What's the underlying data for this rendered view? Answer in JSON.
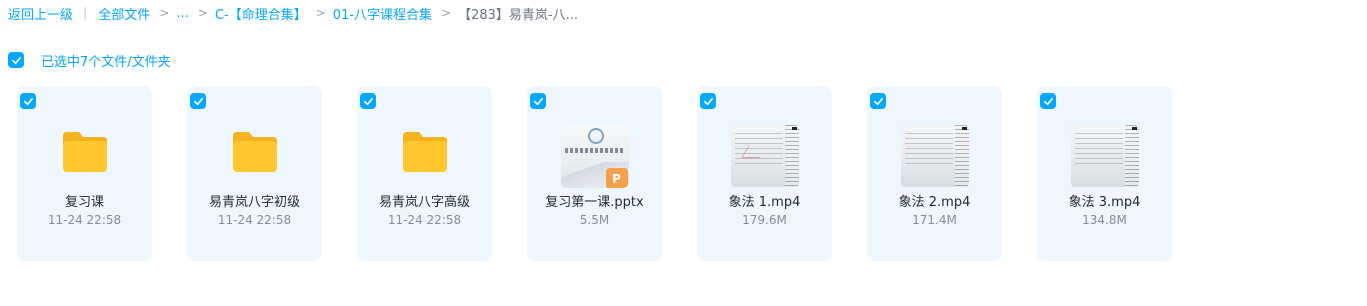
{
  "breadcrumb": {
    "back": "返回上一级",
    "items": [
      "全部文件",
      "...",
      "C-【命理合集】",
      "01-八字课程合集"
    ],
    "current": "【283】易青岚-八..."
  },
  "selection": {
    "label": "已选中7个文件/文件夹"
  },
  "files": [
    {
      "type": "folder",
      "name": "复习课",
      "meta": "11-24 22:58"
    },
    {
      "type": "folder",
      "name": "易青岚八字初级",
      "meta": "11-24 22:58"
    },
    {
      "type": "folder",
      "name": "易青岚八字高级",
      "meta": "11-24 22:58"
    },
    {
      "type": "pptx",
      "name": "复习第一课.pptx",
      "meta": "5.5M",
      "badge": "P"
    },
    {
      "type": "video",
      "name": "象法 1.mp4",
      "meta": "179.6M"
    },
    {
      "type": "video",
      "name": "象法 2.mp4",
      "meta": "171.4M"
    },
    {
      "type": "video",
      "name": "象法 3.mp4",
      "meta": "134.8M"
    }
  ],
  "colors": {
    "accent": "#06a7ff",
    "card_bg": "#eef7fe",
    "folder": "#ffc62e",
    "ppt_badge": "#f5a04a"
  },
  "icons": [
    "check-icon",
    "folder-icon",
    "ppt-thumbnail",
    "video-thumbnail"
  ]
}
